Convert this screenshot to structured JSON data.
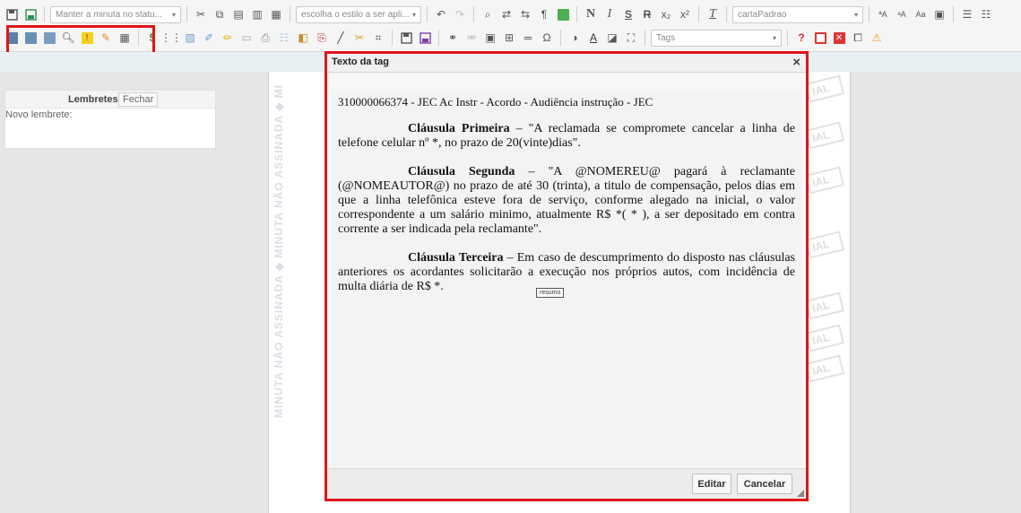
{
  "toolbar": {
    "status_combo": "Manter a minuta no statu...",
    "style_combo": "escolha o estilo a ser apli...",
    "template_combo": "cartaPadrao",
    "tags_combo": "Tags",
    "bold": "N",
    "italic": "I",
    "underline": "S",
    "strike": "R",
    "subscript": "x₂",
    "superscript": "x²",
    "omega": "Ω",
    "help": "?",
    "icons_row1": [
      "save-icon",
      "save-as-icon",
      "cut-icon",
      "copy-icon",
      "paste-icon",
      "paste-text-icon",
      "paste-word-icon",
      "undo-icon",
      "redo-icon",
      "find-icon",
      "replace-icon",
      "select-all-icon",
      "spellcheck-icon",
      "spellcheck-toggle-icon",
      "clear-format-icon",
      "font-size-up-icon",
      "font-size-down-icon",
      "case-icon",
      "paste-special-icon",
      "numbered-list-icon",
      "bullet-list-icon"
    ],
    "icons_row2": [
      "comment-icon",
      "comment-add-icon",
      "comment-view-icon",
      "search-icon",
      "alert-icon",
      "brush-icon",
      "calculator-icon",
      "money-icon",
      "layout-icon",
      "edit-doc-icon",
      "note-icon",
      "pen-icon",
      "table-icon",
      "print-icon",
      "grid-icon",
      "bag-icon",
      "pdf-icon",
      "draw-icon",
      "scissors-icon",
      "code-icon",
      "save-icon",
      "save-as-icon",
      "link-icon",
      "unlink-icon",
      "image-icon",
      "table-icon",
      "line-icon",
      "special-char-icon",
      "contrast-icon",
      "text-color-icon",
      "bg-color-icon",
      "maximize-icon",
      "help-icon",
      "window-icon",
      "close-icon",
      "preview-icon",
      "warning-icon"
    ]
  },
  "watermark": "MINUTA NÃO ASSINADA ◆ MINUTA NÃO ASSINADA ◆ MI",
  "stamp_text": "IAL",
  "reminders": {
    "title": "Lembretes",
    "close_label": "Fechar",
    "placeholder": "Novo lembrete:"
  },
  "dialog": {
    "title": "Texto da tag",
    "close_icon": "×",
    "ref_line": "310000066374 - JEC Ac Instr - Acordo - Audiência instrução - JEC",
    "clauses": [
      {
        "heading": "Cláusula Primeira",
        "text": " – \"A reclamada se compromete cancelar a linha de telefone celular nº *, no prazo de 20(vinte)dias\"."
      },
      {
        "heading": "Cláusula Segunda",
        "text": " – \"A @NOMEREU@ pagará à reclamante (@NOMEAUTOR@) no prazo de até 30 (trinta), a titulo de compensação, pelos dias em que a linha telefônica esteve fora de serviço, conforme alegado na inicial, o valor correspondente a um salário minimo, atualmente R$ *( * ), a ser depositado em contra corrente a ser indicada pela reclamante\"."
      },
      {
        "heading": "Cláusula Terceira",
        "text": " – Em caso de descumprimento do disposto nas cláusulas anteriores os acordantes solicitarão a execução nos próprios autos, com incidência de multa diária de R$ *."
      }
    ],
    "tooltip": "resumo",
    "edit_label": "Editar",
    "cancel_label": "Cancelar"
  }
}
